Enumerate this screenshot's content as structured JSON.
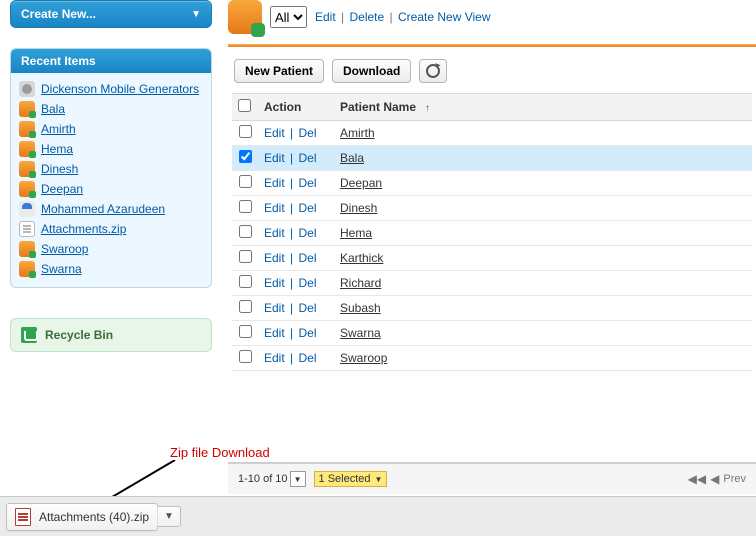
{
  "sidebar": {
    "create_label": "Create New...",
    "recent_header": "Recent Items",
    "recent": [
      {
        "label": "Dickenson Mobile Generators",
        "icon": "account"
      },
      {
        "label": "Bala",
        "icon": "patient"
      },
      {
        "label": "Amirth",
        "icon": "patient"
      },
      {
        "label": "Hema",
        "icon": "patient"
      },
      {
        "label": "Dinesh",
        "icon": "patient"
      },
      {
        "label": "Deepan",
        "icon": "patient"
      },
      {
        "label": "Mohammed Azarudeen",
        "icon": "user"
      },
      {
        "label": "Attachments.zip",
        "icon": "file"
      },
      {
        "label": "Swaroop",
        "icon": "patient"
      },
      {
        "label": "Swarna",
        "icon": "patient"
      }
    ],
    "recycle_label": "Recycle Bin"
  },
  "view": {
    "selected": "All",
    "links": {
      "edit": "Edit",
      "delete": "Delete",
      "create": "Create New View"
    }
  },
  "buttons": {
    "new_patient": "New Patient",
    "download": "Download"
  },
  "grid": {
    "headers": {
      "action": "Action",
      "name": "Patient Name"
    },
    "action_labels": {
      "edit": "Edit",
      "del": "Del"
    },
    "rows": [
      {
        "name": "Amirth",
        "checked": false
      },
      {
        "name": "Bala",
        "checked": true
      },
      {
        "name": "Deepan",
        "checked": false
      },
      {
        "name": "Dinesh",
        "checked": false
      },
      {
        "name": "Hema",
        "checked": false
      },
      {
        "name": "Karthick",
        "checked": false
      },
      {
        "name": "Richard",
        "checked": false
      },
      {
        "name": "Subash",
        "checked": false
      },
      {
        "name": "Swarna",
        "checked": false
      },
      {
        "name": "Swaroop",
        "checked": false
      }
    ]
  },
  "footer": {
    "range": "1-10 of 10",
    "selected": "1 Selected",
    "prev": "Prev"
  },
  "annotation": {
    "zip_label": "Zip file Download"
  },
  "download_bar": {
    "filename": "Attachments (40).zip"
  }
}
